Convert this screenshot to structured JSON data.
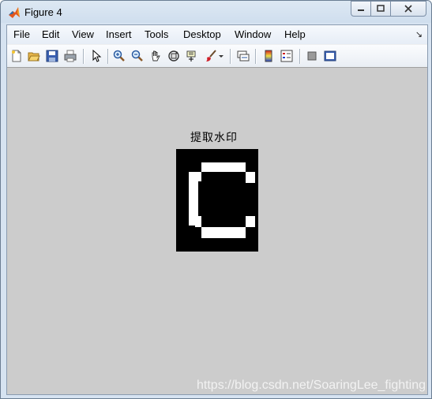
{
  "window": {
    "title": "Figure 4",
    "controls": [
      "minimize-icon",
      "maximize-icon",
      "close-icon"
    ]
  },
  "menubar": {
    "items": [
      "File",
      "Edit",
      "View",
      "Insert",
      "Tools",
      "Desktop",
      "Window",
      "Help"
    ],
    "dock_icon": "dock-arrow-icon"
  },
  "toolbar": {
    "buttons": [
      "new-figure-icon",
      "open-file-icon",
      "save-icon",
      "print-icon",
      "edit-plot-icon",
      "zoom-in-icon",
      "zoom-out-icon",
      "pan-icon",
      "rotate-3d-icon",
      "data-cursor-icon",
      "brush-icon",
      "brush-dropdown-icon",
      "link-plot-icon",
      "insert-colorbar-icon",
      "insert-legend-icon",
      "hide-plot-tools-icon",
      "show-plot-tools-icon"
    ]
  },
  "axes": {
    "title": "提取水印"
  },
  "image": {
    "description_colors": {
      "background": "#000000",
      "foreground": "#ffffff"
    }
  },
  "watermark": "https://blog.csdn.net/SoaringLee_fighting",
  "colors": {
    "canvas_bg": "#cccccc",
    "titlebar_bg": "#cfdeee"
  }
}
